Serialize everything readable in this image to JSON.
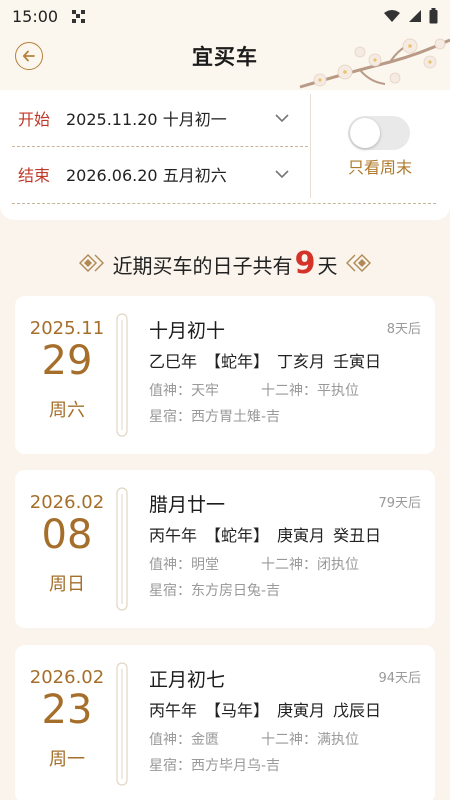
{
  "status_bar": {
    "time": "15:00"
  },
  "header": {
    "title": "宜买车"
  },
  "range": {
    "start_label": "开始",
    "start_value": "2025.11.20 十月初一",
    "end_label": "结束",
    "end_value": "2026.06.20 五月初六",
    "weekend_label": "只看周末",
    "weekend_only": false
  },
  "summary": {
    "prefix": "近期买车的日子共有",
    "count": "9",
    "suffix": "天"
  },
  "days": [
    {
      "year_month": "2025.11",
      "day": "29",
      "weekday": "周六",
      "lunar": "十月初十",
      "days_after": "8天后",
      "ganzhi_year": "乙巳年",
      "zodiac": "【蛇年】",
      "ganzhi_month": "丁亥月",
      "ganzhi_day": "壬寅日",
      "zhishen": "值神：天牢",
      "shiershen": "十二神：平执位",
      "xingxiu": "星宿：西方胃土雉-吉"
    },
    {
      "year_month": "2026.02",
      "day": "08",
      "weekday": "周日",
      "lunar": "腊月廿一",
      "days_after": "79天后",
      "ganzhi_year": "丙午年",
      "zodiac": "【蛇年】",
      "ganzhi_month": "庚寅月",
      "ganzhi_day": "癸丑日",
      "zhishen": "值神：明堂",
      "shiershen": "十二神：闭执位",
      "xingxiu": "星宿：东方房日兔-吉"
    },
    {
      "year_month": "2026.02",
      "day": "23",
      "weekday": "周一",
      "lunar": "正月初七",
      "days_after": "94天后",
      "ganzhi_year": "丙午年",
      "zodiac": "【马年】",
      "ganzhi_month": "庚寅月",
      "ganzhi_day": "戊辰日",
      "zhishen": "值神：金匮",
      "shiershen": "十二神：满执位",
      "xingxiu": "星宿：西方毕月乌-吉"
    }
  ],
  "colors": {
    "accent": "#a56f2b",
    "highlight": "#d4332a",
    "label_red": "#c0392b",
    "page_bg": "#faf4ec"
  },
  "icons": [
    "back-arrow-icon",
    "wifi-icon",
    "signal-icon",
    "battery-icon",
    "chevron-down-icon",
    "diamond-ornament-icon"
  ]
}
